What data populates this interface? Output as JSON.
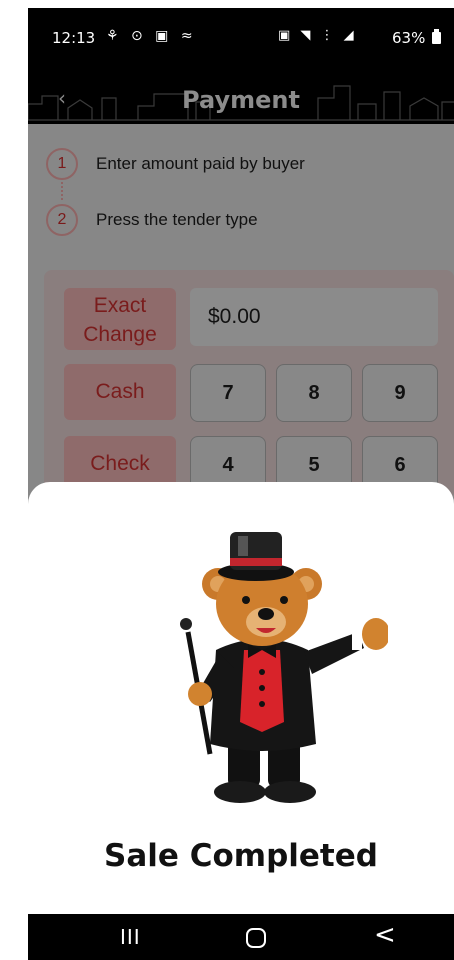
{
  "status_bar": {
    "time": "12:13",
    "left_icons": "⚘ ⊙ ▣ ≈",
    "right_icons": "▣ ◥ ⋮ ◢",
    "battery": "63%"
  },
  "header": {
    "title": "Payment",
    "back_icon": "chevron-left-icon"
  },
  "steps": [
    {
      "number": "1",
      "text": "Enter amount paid by buyer"
    },
    {
      "number": "2",
      "text": "Press the tender type"
    }
  ],
  "tender_buttons": {
    "exact_line1": "Exact",
    "exact_line2": "Change",
    "cash": "Cash",
    "check": "Check"
  },
  "amount": "$0.00",
  "keypad": [
    "7",
    "8",
    "9",
    "4",
    "5",
    "6"
  ],
  "sheet": {
    "message": "Sale Completed",
    "image": "bear-mascot-tuxedo-top-hat"
  },
  "nav": {
    "recents": "III",
    "back": "<"
  },
  "colors": {
    "accent": "#c0262d",
    "overlay": "#878787",
    "header_bg": "#000000"
  }
}
